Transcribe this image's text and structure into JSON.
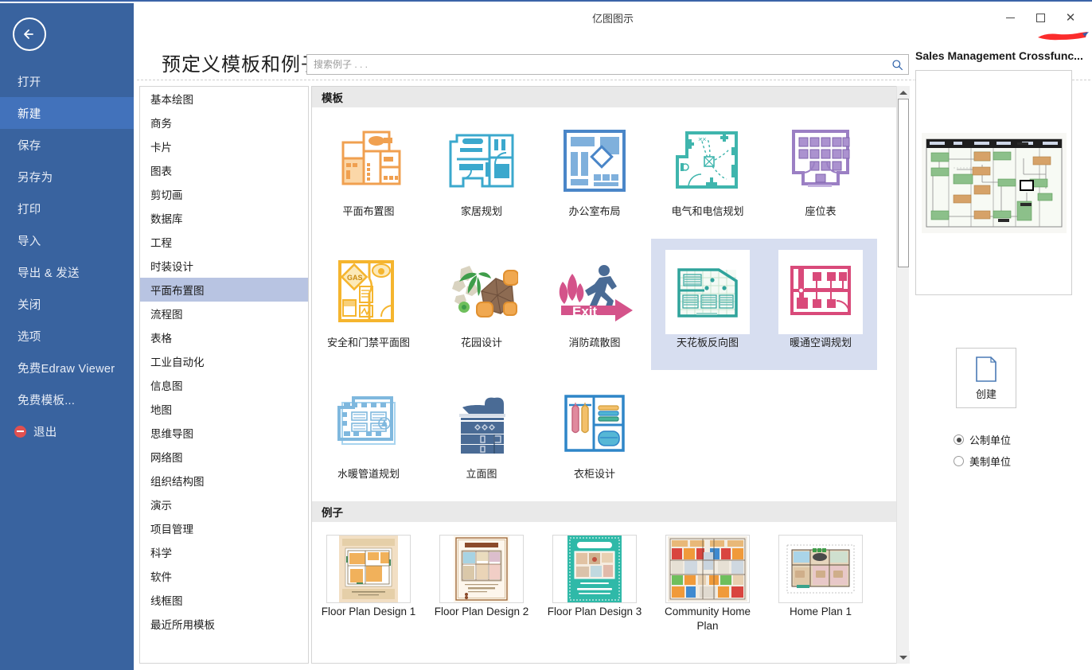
{
  "window": {
    "title": "亿图图示",
    "minimize_label": "最小化",
    "maximize_label": "最大化",
    "close_label": "关闭"
  },
  "sidebar": {
    "back_icon": "back-arrow-icon",
    "items": [
      {
        "label": "打开",
        "active": false
      },
      {
        "label": "新建",
        "active": true
      },
      {
        "label": "保存",
        "active": false
      },
      {
        "label": "另存为",
        "active": false
      },
      {
        "label": "打印",
        "active": false
      },
      {
        "label": "导入",
        "active": false
      },
      {
        "label": "导出 & 发送",
        "active": false
      },
      {
        "label": "关闭",
        "active": false
      },
      {
        "label": "选项",
        "active": false
      },
      {
        "label": "免费Edraw Viewer",
        "active": false
      },
      {
        "label": "免费模板...",
        "active": false
      }
    ],
    "exit_label": "退出",
    "exit_icon": "exit-icon",
    "bg_color": "#39639f",
    "active_color": "#4272bb"
  },
  "header": {
    "page_title": "预定义模板和例子",
    "search_placeholder": "搜索例子 . . .",
    "search_value": "",
    "search_icon": "search-icon"
  },
  "categories": {
    "items": [
      {
        "label": "基本绘图",
        "active": false
      },
      {
        "label": "商务",
        "active": false
      },
      {
        "label": "卡片",
        "active": false
      },
      {
        "label": "图表",
        "active": false
      },
      {
        "label": "剪切画",
        "active": false
      },
      {
        "label": "数据库",
        "active": false
      },
      {
        "label": "工程",
        "active": false
      },
      {
        "label": "时装设计",
        "active": false
      },
      {
        "label": "平面布置图",
        "active": true
      },
      {
        "label": "流程图",
        "active": false
      },
      {
        "label": "表格",
        "active": false
      },
      {
        "label": "工业自动化",
        "active": false
      },
      {
        "label": "信息图",
        "active": false
      },
      {
        "label": "地图",
        "active": false
      },
      {
        "label": "思维导图",
        "active": false
      },
      {
        "label": "网络图",
        "active": false
      },
      {
        "label": "组织结构图",
        "active": false
      },
      {
        "label": "演示",
        "active": false
      },
      {
        "label": "项目管理",
        "active": false
      },
      {
        "label": "科学",
        "active": false
      },
      {
        "label": "软件",
        "active": false
      },
      {
        "label": "线框图",
        "active": false
      },
      {
        "label": "最近所用模板",
        "active": false
      }
    ],
    "selected_color": "#b8c4e2"
  },
  "templates_section": {
    "heading": "模板",
    "items": [
      {
        "label": "平面布置图",
        "icon": "floor-plan-icon",
        "accent": "#f0a050",
        "selected": false
      },
      {
        "label": "家居规划",
        "icon": "home-plan-icon",
        "accent": "#3ba8cd",
        "selected": false
      },
      {
        "label": "办公室布局",
        "icon": "office-layout-icon",
        "accent": "#4a86c8",
        "selected": false
      },
      {
        "label": "电气和电信规划",
        "icon": "electrical-plan-icon",
        "accent": "#3fb5ad",
        "selected": false
      },
      {
        "label": "座位表",
        "icon": "seating-chart-icon",
        "accent": "#9b7fc4",
        "selected": false
      },
      {
        "label": "安全和门禁平面图",
        "icon": "security-plan-icon",
        "accent": "#f5b52e",
        "selected": false
      },
      {
        "label": "花园设计",
        "icon": "garden-design-icon",
        "accent": "#8d6b52",
        "selected": false
      },
      {
        "label": "消防疏散图",
        "icon": "fire-exit-icon",
        "accent": "#d4538a",
        "selected": false
      },
      {
        "label": "天花板反向图",
        "icon": "ceiling-plan-icon",
        "accent": "#2fa39b",
        "selected": true
      },
      {
        "label": "暖通空调规划",
        "icon": "hvac-plan-icon",
        "accent": "#d94a7a",
        "selected": true
      },
      {
        "label": "水暖管道规划",
        "icon": "plumbing-plan-icon",
        "accent": "#7fb8de",
        "selected": false
      },
      {
        "label": "立面图",
        "icon": "elevation-icon",
        "accent": "#4a6b95",
        "selected": false
      },
      {
        "label": "衣柜设计",
        "icon": "wardrobe-design-icon",
        "accent": "#2f86c8",
        "selected": false
      }
    ],
    "selected_bg": "#d7def0"
  },
  "examples_section": {
    "heading": "例子",
    "items": [
      {
        "label": "Floor Plan Design 1",
        "icon": "floor-plan-design-1-thumb"
      },
      {
        "label": "Floor Plan Design 2",
        "icon": "floor-plan-design-2-thumb"
      },
      {
        "label": "Floor Plan Design 3",
        "icon": "floor-plan-design-3-thumb"
      },
      {
        "label": "Community Home Plan",
        "icon": "community-home-plan-thumb"
      },
      {
        "label": "Home Plan 1",
        "icon": "home-plan-1-thumb"
      }
    ]
  },
  "right_panel": {
    "preview_title": "Sales Management Crossfunc...",
    "preview_icon": "crossfunctional-flowchart-preview",
    "create_label": "创建",
    "create_icon": "new-document-icon",
    "units": [
      {
        "label": "公制单位",
        "selected": true
      },
      {
        "label": "美制单位",
        "selected": false
      }
    ]
  },
  "scrollbar": {
    "up_icon": "scroll-up-arrow-icon",
    "down_icon": "scroll-down-arrow-icon"
  }
}
